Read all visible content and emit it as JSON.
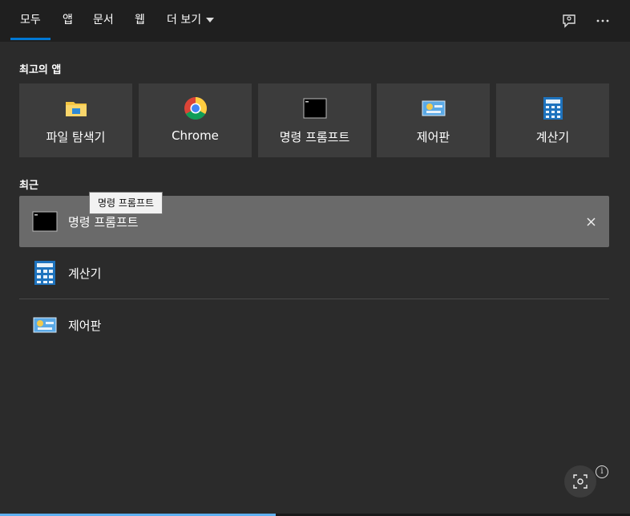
{
  "tabs": [
    {
      "label": "모두",
      "active": true
    },
    {
      "label": "앱"
    },
    {
      "label": "문서"
    },
    {
      "label": "웹"
    },
    {
      "label": "더 보기"
    }
  ],
  "header_icons": [
    "feedback-icon",
    "more-icon"
  ],
  "sections": {
    "top_apps": "최고의 앱",
    "recent": "최근"
  },
  "top_apps": [
    {
      "label": "파일 탐색기",
      "icon": "folder-icon"
    },
    {
      "label": "Chrome",
      "icon": "chrome-icon"
    },
    {
      "label": "명령 프롬프트",
      "icon": "terminal-icon"
    },
    {
      "label": "제어판",
      "icon": "control-panel-icon"
    },
    {
      "label": "계산기",
      "icon": "calculator-icon"
    }
  ],
  "recent": [
    {
      "label": "명령 프롬프트",
      "icon": "terminal-icon",
      "selected": true
    },
    {
      "label": "계산기",
      "icon": "calculator-icon"
    },
    {
      "label": "제어판",
      "icon": "control-panel-icon"
    }
  ],
  "tooltip": "명령 프롬프트",
  "info_symbol": "i",
  "colors": {
    "accent": "#0078d4",
    "background": "#2b2b2b",
    "tile": "#3c3c3c",
    "selected_row": "#6a6a6a"
  }
}
